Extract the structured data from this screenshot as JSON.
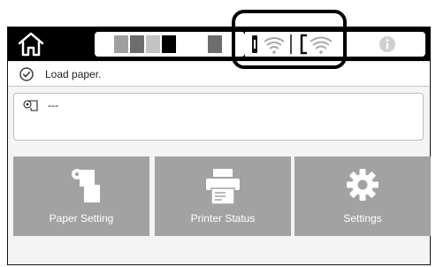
{
  "topbar": {
    "home_icon": "home-icon",
    "ink_colors": [
      "#ffffff",
      "#9f9f9f",
      "#6d6d6d",
      "#c3c3c3",
      "#000000",
      "#ffffff",
      "#6d6d6d"
    ],
    "printer_wifi_icon": "printer-wifi-icon",
    "phone_wifi_icon": "phone-wifi-icon",
    "info_icon": "info-icon"
  },
  "status": {
    "icon": "check-circle-icon",
    "text": "Load paper."
  },
  "paper": {
    "icon": "roll-paper-icon",
    "text": "---"
  },
  "tiles": [
    {
      "label": "Paper Setting",
      "icon": "paper-setting-icon"
    },
    {
      "label": "Printer Status",
      "icon": "printer-status-icon"
    },
    {
      "label": "Settings",
      "icon": "settings-gear-icon"
    }
  ]
}
